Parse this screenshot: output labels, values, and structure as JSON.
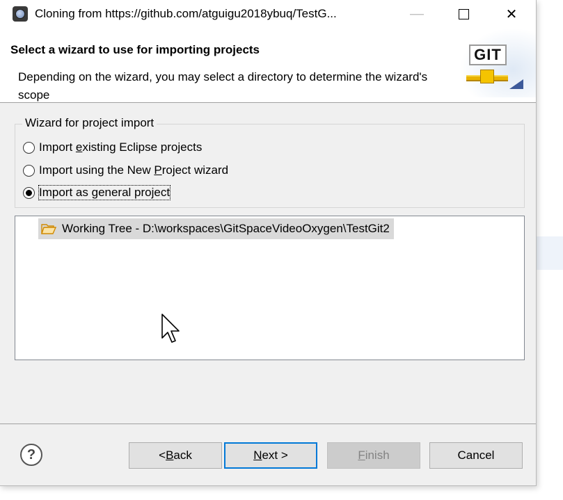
{
  "window": {
    "title": "Cloning from https://github.com/atguigu2018ybuq/TestG...",
    "minimize_glyph": "—",
    "close_glyph": "✕"
  },
  "header": {
    "title": "Select a wizard to use for importing projects",
    "description": "Depending on the wizard, you may select a directory to determine the wizard's scope",
    "logo_text": "GIT"
  },
  "wizard_group": {
    "legend": "Wizard for project import",
    "options": [
      {
        "pre": "Import ",
        "mnemonic": "e",
        "post": "xisting Eclipse projects",
        "selected": false
      },
      {
        "pre": "Import using the New ",
        "mnemonic": "P",
        "post": "roject wizard",
        "selected": false
      },
      {
        "pre": "Import as ",
        "mnemonic": "g",
        "post": "eneral project",
        "selected": true
      }
    ]
  },
  "tree": {
    "item_label": "Working Tree - D:\\workspaces\\GitSpaceVideoOxygen\\TestGit2"
  },
  "footer": {
    "help_glyph": "?",
    "back": {
      "pre": "< ",
      "mnemonic": "B",
      "post": "ack"
    },
    "next": {
      "pre": "",
      "mnemonic": "N",
      "post": "ext >"
    },
    "finish": {
      "pre": "",
      "mnemonic": "F",
      "post": "inish"
    },
    "cancel": "Cancel"
  },
  "colors": {
    "accent": "#0078d7",
    "selection": "#d9d9d9",
    "folder": "#e8a317"
  }
}
